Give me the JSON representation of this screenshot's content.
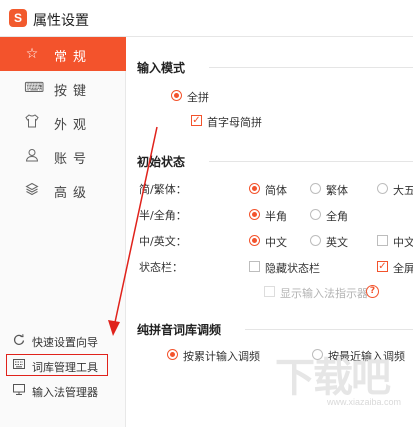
{
  "app": {
    "logo": "S",
    "title": "属性设置"
  },
  "sidebar": {
    "nav": [
      {
        "label": "常规",
        "icon": "star-icon",
        "active": true
      },
      {
        "label": "按键",
        "icon": "keyboard-icon",
        "active": false
      },
      {
        "label": "外观",
        "icon": "tshirt-icon",
        "active": false
      },
      {
        "label": "账号",
        "icon": "user-icon",
        "active": false
      },
      {
        "label": "高级",
        "icon": "layers-icon",
        "active": false
      }
    ],
    "tools": [
      {
        "label": "快速设置向导",
        "icon": "refresh-icon"
      },
      {
        "label": "词库管理工具",
        "icon": "keyboard-icon",
        "highlighted": true
      },
      {
        "label": "输入法管理器",
        "icon": "monitor-icon"
      }
    ]
  },
  "main": {
    "input_mode": {
      "title": "输入模式",
      "quanpin": "全拼",
      "shouzimu": "首字母简拼"
    },
    "initial_state": {
      "title": "初始状态",
      "rows": [
        {
          "label": "简/繁体：",
          "options": [
            "简体",
            "繁体",
            "大五"
          ]
        },
        {
          "label": "半/全角：",
          "options": [
            "半角",
            "全角"
          ]
        },
        {
          "label": "中/英文：",
          "options": [
            "中文",
            "英文",
            "中文"
          ]
        },
        {
          "label": "状态栏：",
          "options": [
            "隐藏状态栏",
            "全屏"
          ]
        }
      ],
      "show_indicator": "显示输入法指示器",
      "help": "?"
    },
    "freq": {
      "title": "纯拼音词库调频",
      "opt1": "按累计输入调频",
      "opt2": "按最近输入调频"
    }
  },
  "watermark": {
    "text": "下载吧",
    "url": "www.xiazaiba.com"
  },
  "colors": {
    "accent": "#f3532c",
    "annotation": "#e0221b"
  }
}
